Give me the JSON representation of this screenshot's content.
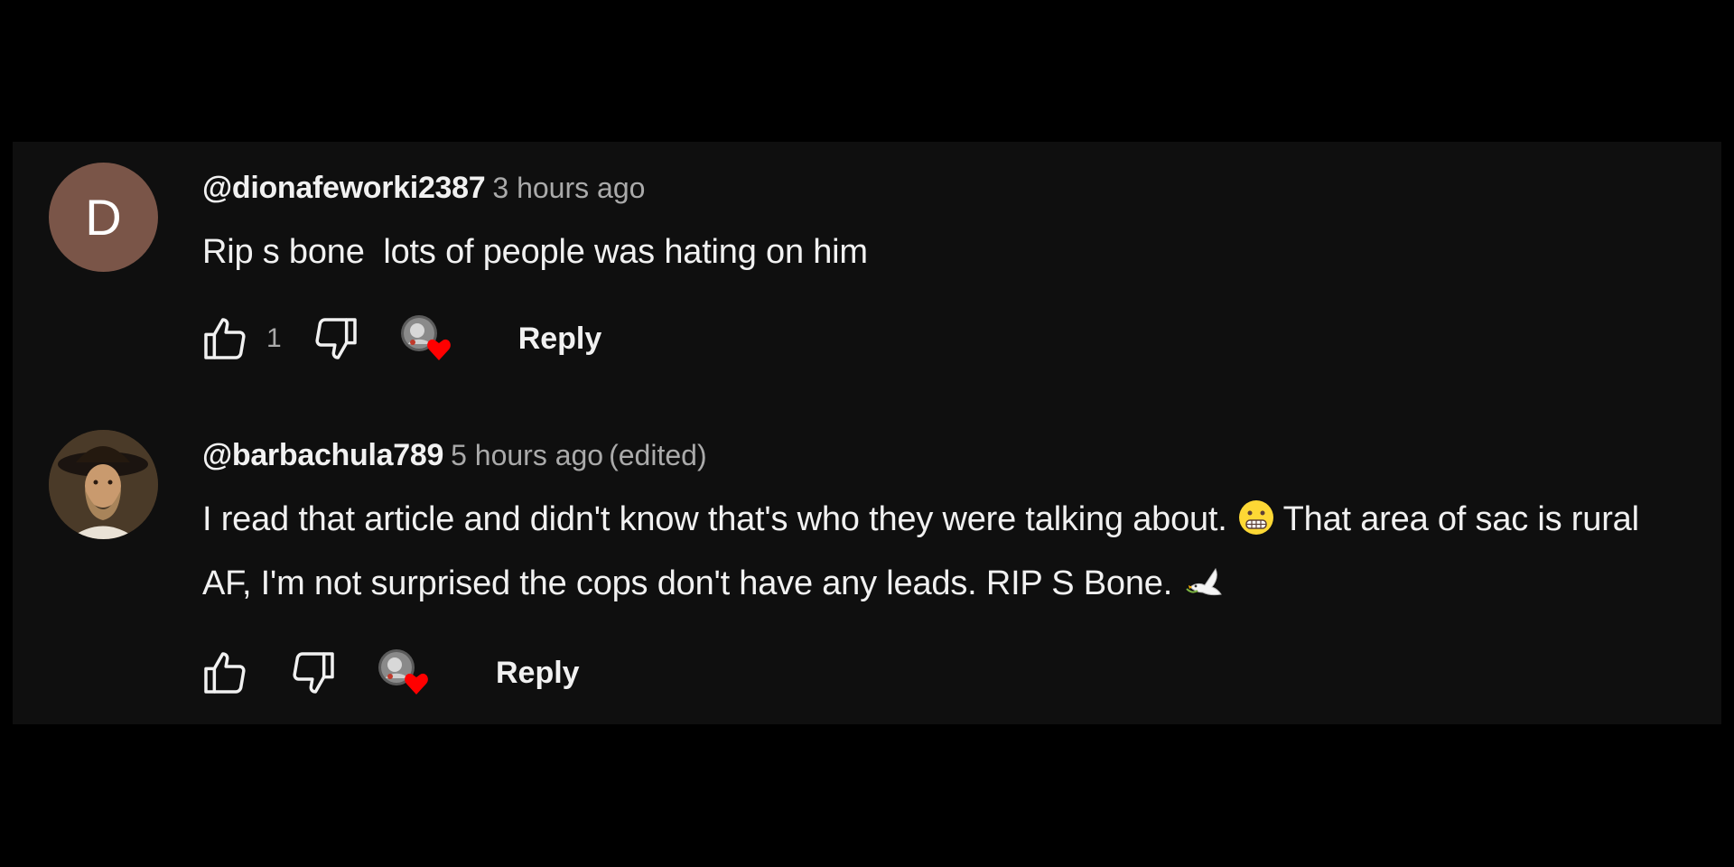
{
  "comments": [
    {
      "avatar_letter": "D",
      "author": "@dionafeworki2387",
      "time": "3 hours ago",
      "edited": "",
      "text": "Rip s bone  lots of people was hating on him",
      "likes": "1",
      "reply_label": "Reply"
    },
    {
      "author": "@barbachula789",
      "time": "5 hours ago",
      "edited": "(edited)",
      "text_part1": "I read that article and didn't know that's who they were talking about.",
      "text_part2": "That area of sac is rural AF, I'm not surprised the cops don't have any leads. RIP S Bone.",
      "likes": "",
      "reply_label": "Reply"
    }
  ],
  "colors": {
    "background": "#000000",
    "panel": "#0f0f0f",
    "text": "#f1f1f1",
    "secondary": "#aaaaaa",
    "heart": "#ff0000",
    "avatar_d": "#7a5548"
  },
  "icons": [
    "like-icon",
    "dislike-icon",
    "creator-heart-icon",
    "grimacing-emoji",
    "dove-emoji"
  ]
}
